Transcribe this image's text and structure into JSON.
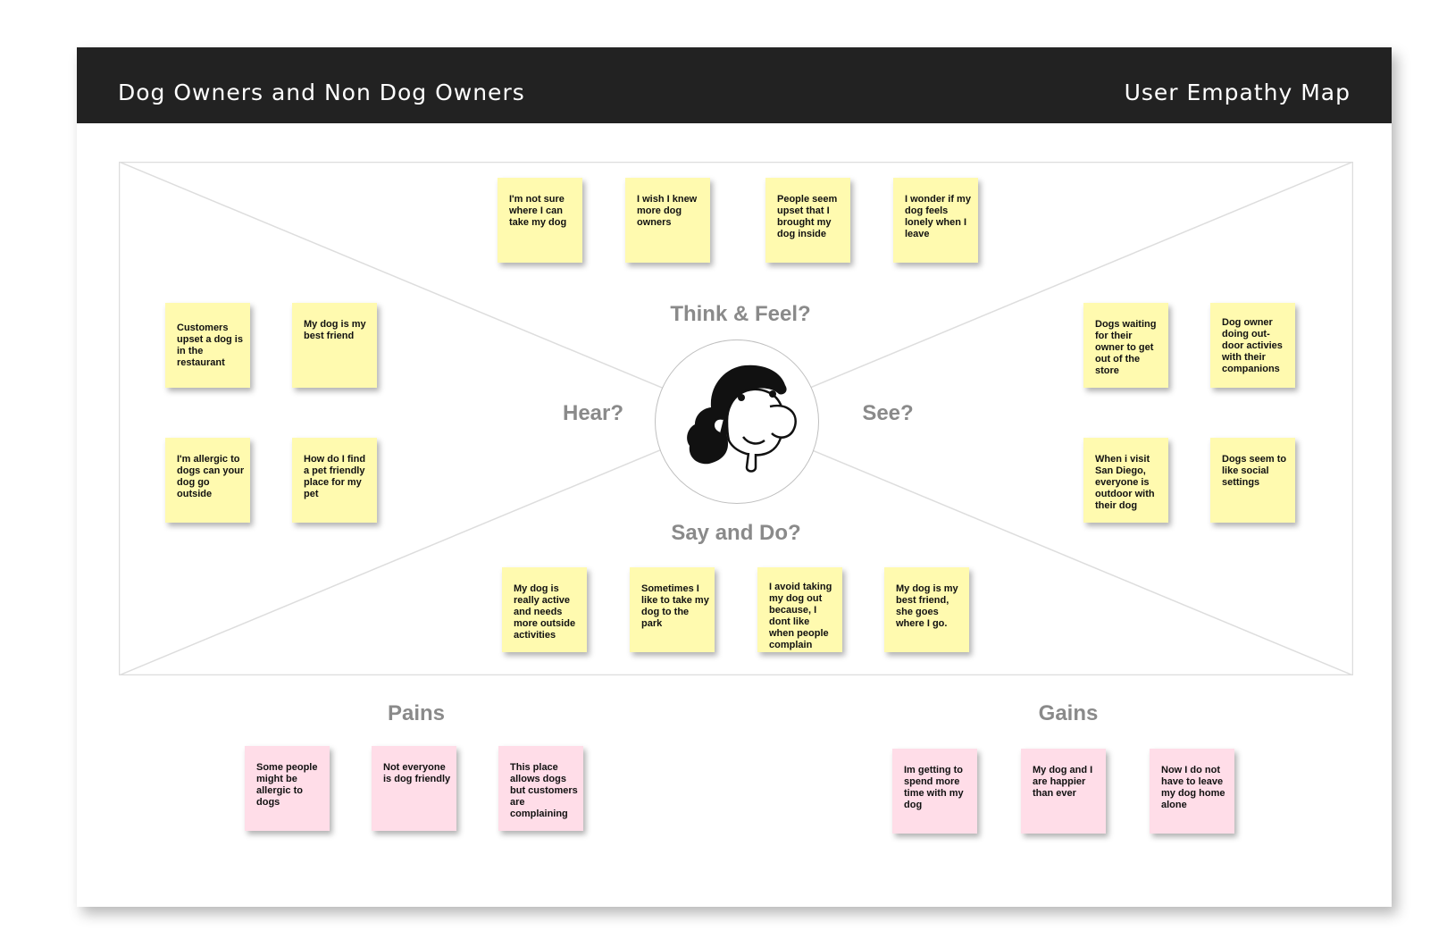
{
  "header": {
    "title": "Dog Owners and Non Dog Owners",
    "subtitle": "User Empathy Map"
  },
  "quadrants": {
    "think_feel": "Think & Feel?",
    "hear": "Hear?",
    "see": "See?",
    "say_do": "Say and Do?"
  },
  "think_feel_notes": [
    "I'm not sure where I can take my dog",
    "I wish I knew more dog owners",
    "People seem upset that I brought my dog inside",
    "I wonder if my dog feels lonely when I leave"
  ],
  "hear_notes": [
    "Customers upset a dog is in the restaurant",
    "My dog is my best friend",
    "I'm allergic to dogs can your dog go outside",
    "How do I find a pet friendly place for my pet"
  ],
  "see_notes": [
    "Dogs waiting for their owner to get out of the store",
    "Dog owner doing out-door activies with their companions",
    "When i visit San Diego, everyone is outdoor with their dog",
    "Dogs seem to like social settings"
  ],
  "say_do_notes": [
    "My dog is really active and needs more outside activities",
    "Sometimes I like to take my dog to the park",
    "I avoid taking my dog out because, I dont like when people complain",
    "My dog is my best friend, she goes where I go."
  ],
  "pains": {
    "title": "Pains",
    "notes": [
      "Some people might be allergic to dogs",
      "Not everyone is dog friendly",
      "This place allows dogs but customers are complaining"
    ]
  },
  "gains": {
    "title": "Gains",
    "notes": [
      "Im getting to spend more time with my dog",
      "My dog and I are happier than ever",
      "Now I do not have to leave my dog home alone"
    ]
  },
  "colors": {
    "header_bg": "#222222",
    "sticky_yellow": "#fffaaf",
    "sticky_pink": "#ffdde8",
    "label_gray": "#8a8a8a"
  },
  "icons": {
    "persona": "woman-avatar-icon"
  }
}
